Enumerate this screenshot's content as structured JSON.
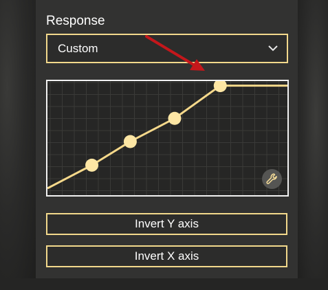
{
  "response": {
    "label": "Response",
    "selected": "Custom"
  },
  "curve": {
    "title": "response-curve",
    "points_fraction": [
      [
        0.0,
        0.06
      ],
      [
        0.185,
        0.263
      ],
      [
        0.345,
        0.47
      ],
      [
        0.53,
        0.673
      ],
      [
        0.72,
        0.96
      ],
      [
        1.0,
        0.96
      ]
    ],
    "handles": [
      1,
      2,
      3,
      4
    ],
    "line_color": "#f6d98b",
    "handle_color": "#fde6a4"
  },
  "settings_icon": "wrench-icon",
  "buttons": {
    "invert_y": "Invert Y axis",
    "invert_x": "Invert X axis"
  },
  "colors": {
    "accent": "#f3d98c",
    "annotation_arrow": "#c4171b"
  }
}
